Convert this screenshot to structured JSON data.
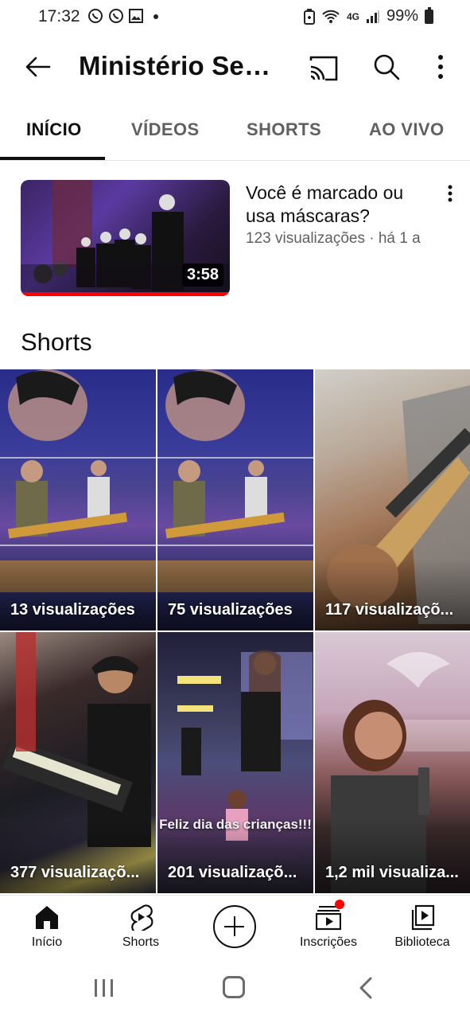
{
  "status_bar": {
    "time": "17:32",
    "network": "4G",
    "battery": "99%",
    "left_icons": [
      "whatsapp-icon",
      "whatsapp-icon",
      "gallery-icon"
    ],
    "right_icons": [
      "battery-saver-icon",
      "wifi-icon",
      "signal-icon",
      "battery-icon"
    ]
  },
  "app_bar": {
    "title": "Ministério Sete…",
    "icons": [
      "back-arrow-icon",
      "cast-icon",
      "search-icon",
      "more-vert-icon"
    ]
  },
  "tabs": [
    {
      "label": "INÍCIO",
      "active": true
    },
    {
      "label": "VÍDEOS",
      "active": false
    },
    {
      "label": "SHORTS",
      "active": false
    },
    {
      "label": "AO VIVO",
      "active": false
    }
  ],
  "featured_video": {
    "title": "Você é marcado ou usa máscaras?",
    "views": "123 visualizações · há 1 a",
    "duration": "3:58"
  },
  "shorts": {
    "heading": "Shorts",
    "items": [
      {
        "views": "13 visualizações"
      },
      {
        "views": "75 visualizações"
      },
      {
        "views": "117 visualizaçõ..."
      },
      {
        "views": "377 visualizaçõ..."
      },
      {
        "views": "201 visualizaçõ...",
        "caption": "Feliz dia das crianças!!!"
      },
      {
        "views": "1,2 mil visualiza..."
      }
    ]
  },
  "bottom_nav": {
    "items": [
      {
        "label": "Início",
        "icon": "home-icon"
      },
      {
        "label": "Shorts",
        "icon": "shorts-icon"
      },
      {
        "label": "",
        "icon": "create-icon"
      },
      {
        "label": "Inscrições",
        "icon": "subscriptions-icon"
      },
      {
        "label": "Biblioteca",
        "icon": "library-icon"
      }
    ],
    "accent": "#ff0000"
  },
  "system_nav": [
    "recents-icon",
    "home-button-icon",
    "back-icon"
  ]
}
